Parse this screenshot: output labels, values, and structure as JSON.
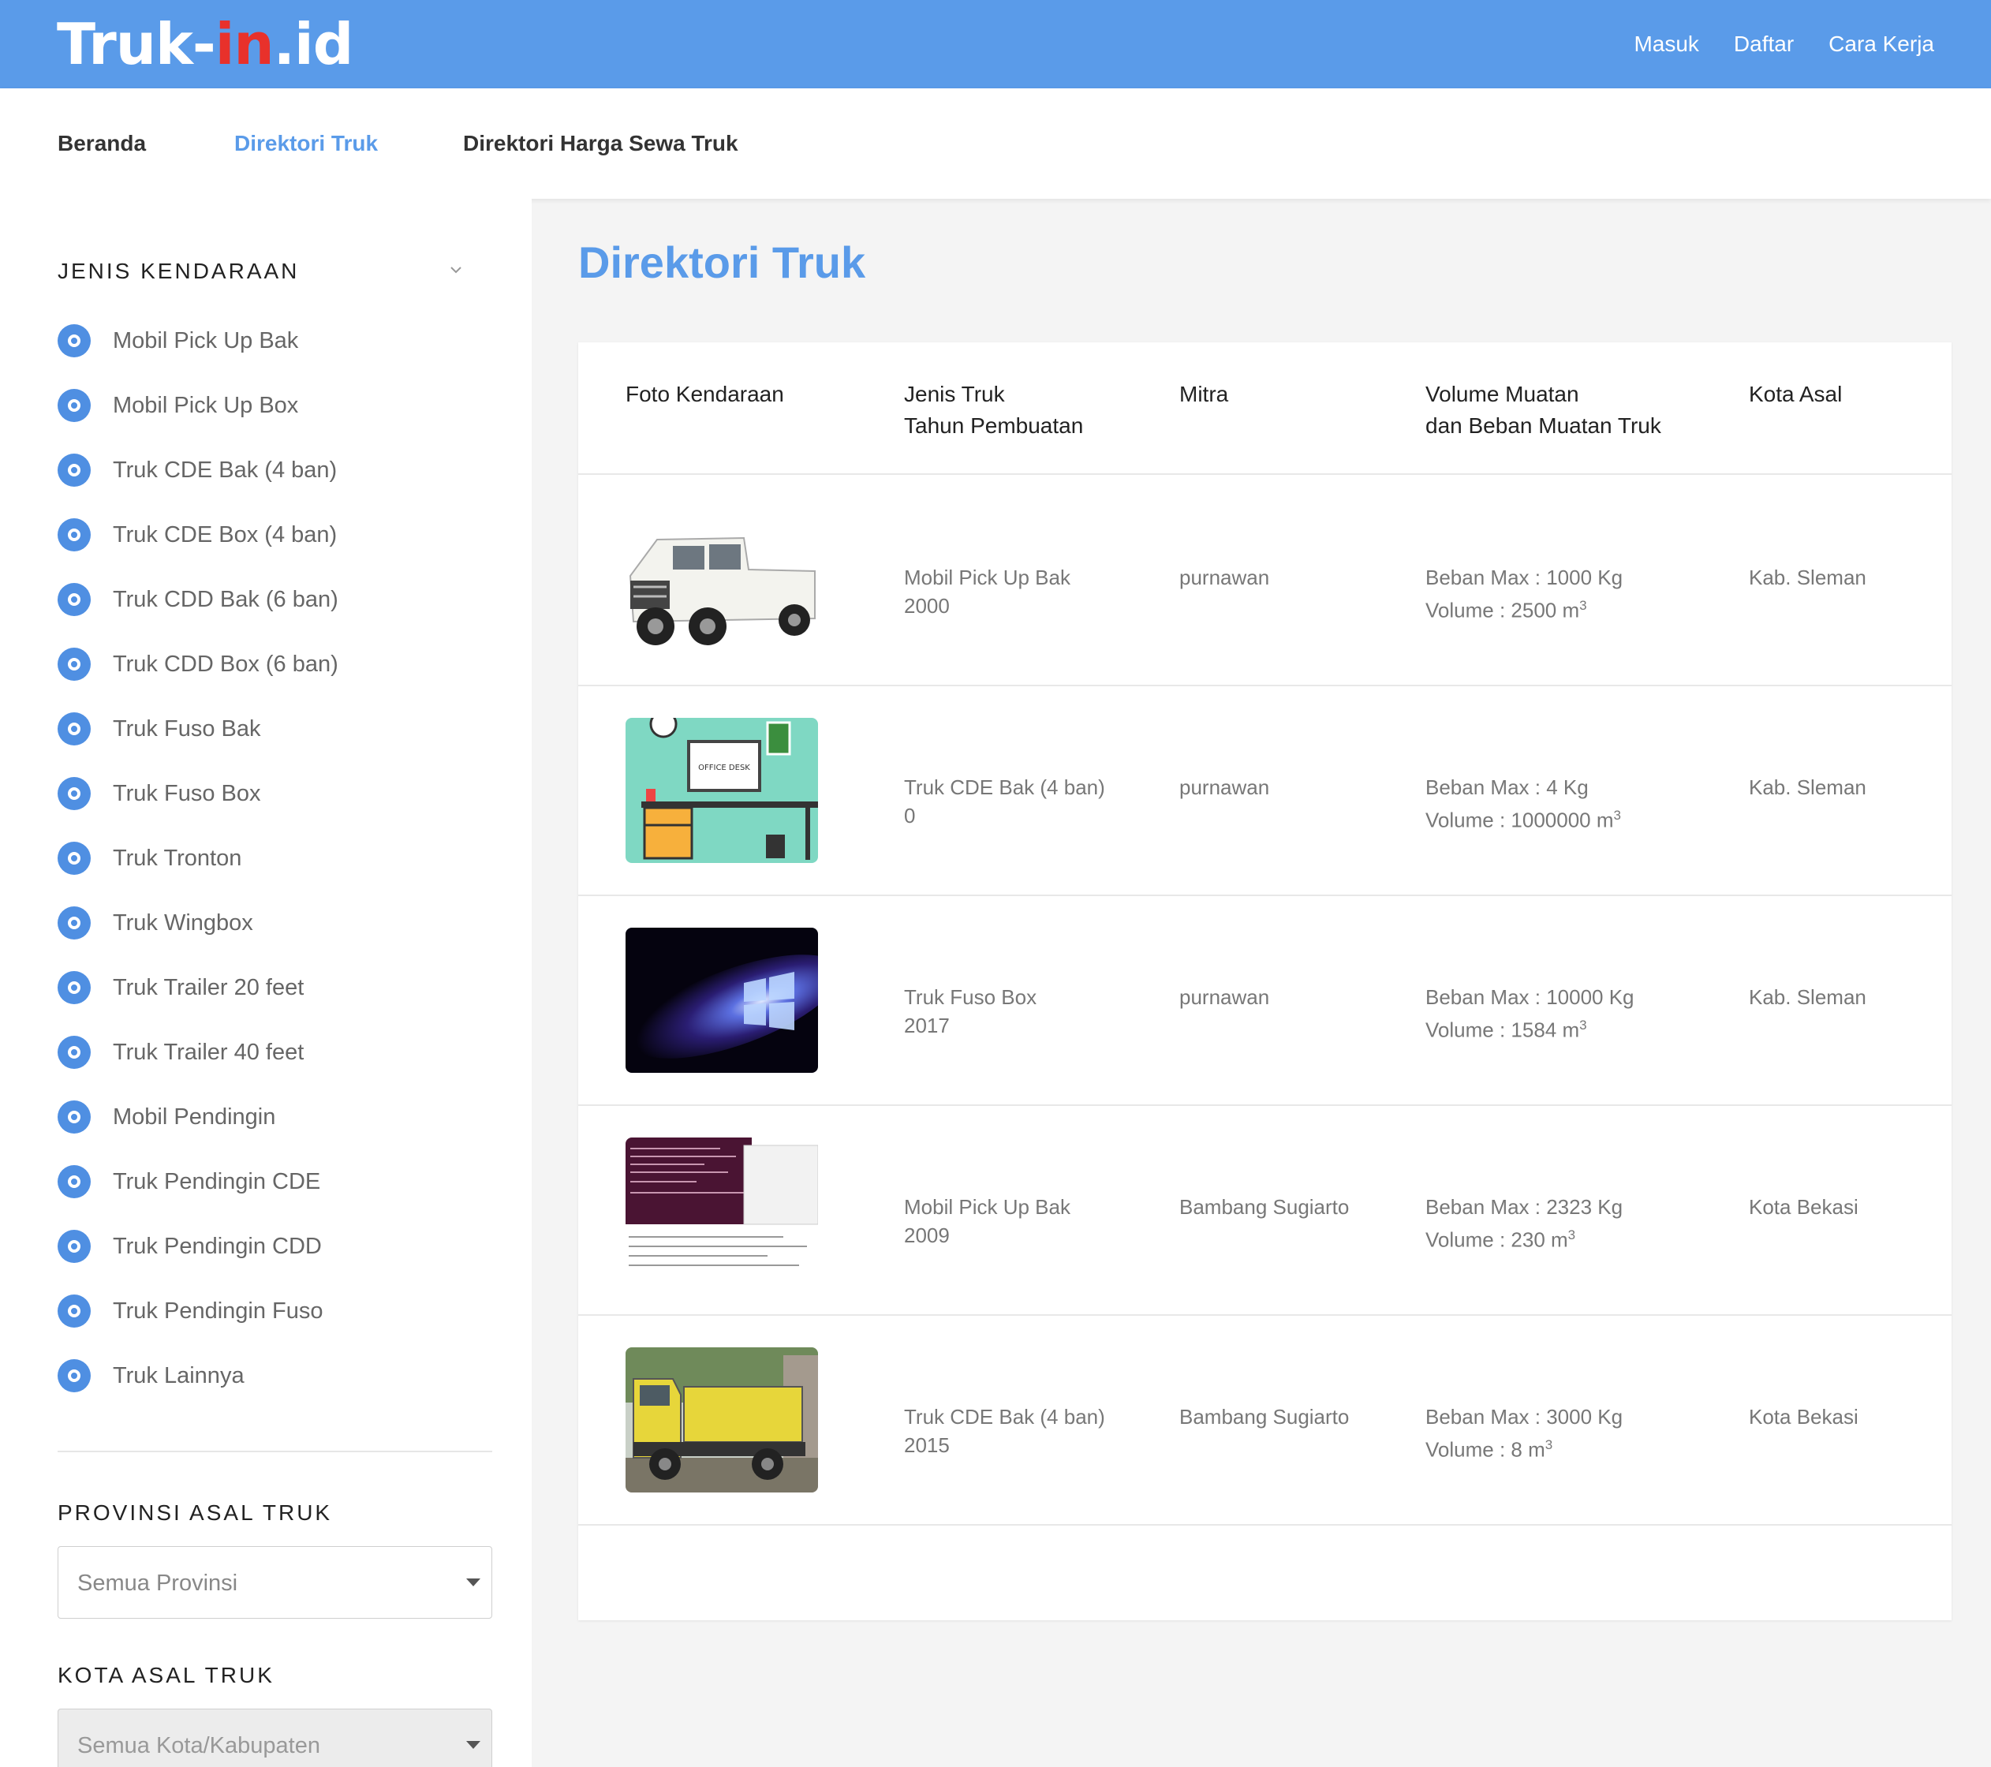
{
  "brand": {
    "part1": "Truk-",
    "part2": "in",
    "part3": ".id"
  },
  "topnav": {
    "login": "Masuk",
    "register": "Daftar",
    "howto": "Cara Kerja"
  },
  "subnav": {
    "home": "Beranda",
    "directory": "Direktori Truk",
    "price_directory": "Direktori Harga Sewa Truk"
  },
  "sidebar": {
    "vehicle_heading": "JENIS KENDARAAN",
    "vehicle_types": [
      "Mobil Pick Up Bak",
      "Mobil Pick Up Box",
      "Truk CDE Bak (4 ban)",
      "Truk CDE Box (4 ban)",
      "Truk CDD Bak (6 ban)",
      "Truk CDD Box (6 ban)",
      "Truk Fuso Bak",
      "Truk Fuso Box",
      "Truk Tronton",
      "Truk Wingbox",
      "Truk Trailer 20 feet",
      "Truk Trailer 40 feet",
      "Mobil Pendingin",
      "Truk Pendingin CDE",
      "Truk Pendingin CDD",
      "Truk Pendingin Fuso",
      "Truk Lainnya"
    ],
    "province_heading": "PROVINSI ASAL TRUK",
    "province_value": "Semua Provinsi",
    "city_heading": "KOTA ASAL TRUK",
    "city_value": "Semua Kota/Kabupaten"
  },
  "main": {
    "title": "Direktori Truk",
    "headers": {
      "photo": "Foto Kendaraan",
      "type_line1": "Jenis Truk",
      "type_line2": "Tahun Pembuatan",
      "partner": "Mitra",
      "volume_line1": "Volume Muatan",
      "volume_line2": "dan Beban Muatan Truk",
      "city": "Kota Asal"
    },
    "unit_sup": "3",
    "rows": [
      {
        "type": "Mobil Pick Up Bak",
        "year": "2000",
        "partner": "purnawan",
        "load": "Beban Max : 1000 Kg",
        "volume": "Volume : 2500 m",
        "city": "Kab. Sleman",
        "thumb": "white-pickup-truck"
      },
      {
        "type": "Truk CDE Bak (4 ban)",
        "year": "0",
        "partner": "purnawan",
        "load": "Beban Max : 4 Kg",
        "volume": "Volume : 1000000 m",
        "city": "Kab. Sleman",
        "thumb": "office-desk-illustration",
        "thumb_text": "OFFICE DESK"
      },
      {
        "type": "Truk Fuso Box",
        "year": "2017",
        "partner": "purnawan",
        "load": "Beban Max : 10000 Kg",
        "volume": "Volume : 1584 m",
        "city": "Kab. Sleman",
        "thumb": "galaxy-windows-wallpaper"
      },
      {
        "type": "Mobil Pick Up Bak",
        "year": "2009",
        "partner": "Bambang Sugiarto",
        "load": "Beban Max : 2323 Kg",
        "volume": "Volume : 230 m",
        "city": "Kota Bekasi",
        "thumb": "terminal-screenshot"
      },
      {
        "type": "Truk CDE Bak (4 ban)",
        "year": "2015",
        "partner": "Bambang Sugiarto",
        "load": "Beban Max : 3000 Kg",
        "volume": "Volume : 8 m",
        "city": "Kota Bekasi",
        "thumb": "yellow-dump-truck"
      }
    ]
  },
  "colors": {
    "primary": "#5a9be9",
    "logo_accent": "#e8312b",
    "radio": "#4f8fe2"
  }
}
